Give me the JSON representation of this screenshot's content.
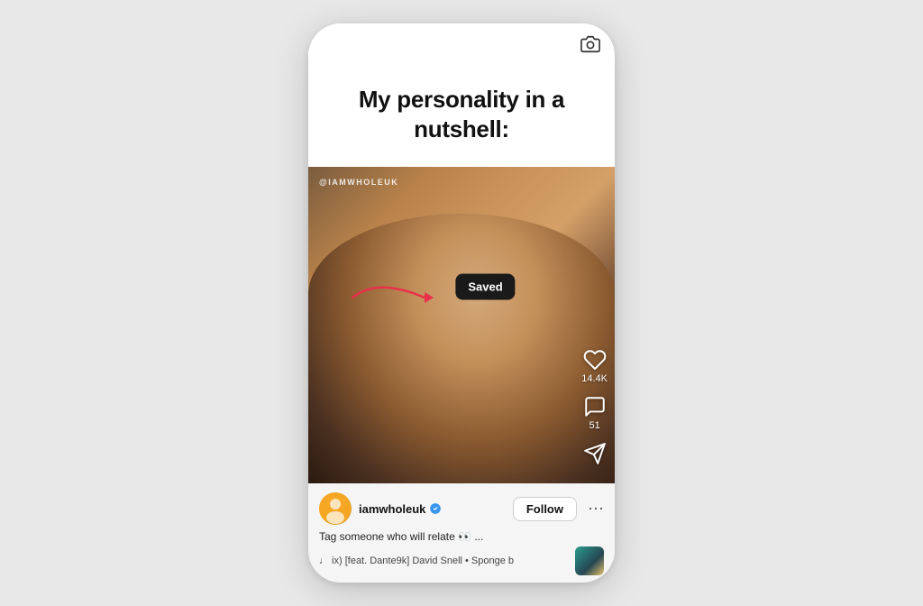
{
  "phone": {
    "slide": {
      "text": "My personality in a nutshell:"
    },
    "video": {
      "watermark": "@IAMWHOLEUK",
      "saved_label": "Saved",
      "likes_count": "14.4K",
      "comments_count": "51"
    },
    "bottom": {
      "username": "iamwholeuk",
      "follow_label": "Follow",
      "caption": "Tag someone who will relate 👀 ...",
      "music_text": "♩ ix) [feat. Dante9k]  David Snell • Sponge b"
    }
  }
}
